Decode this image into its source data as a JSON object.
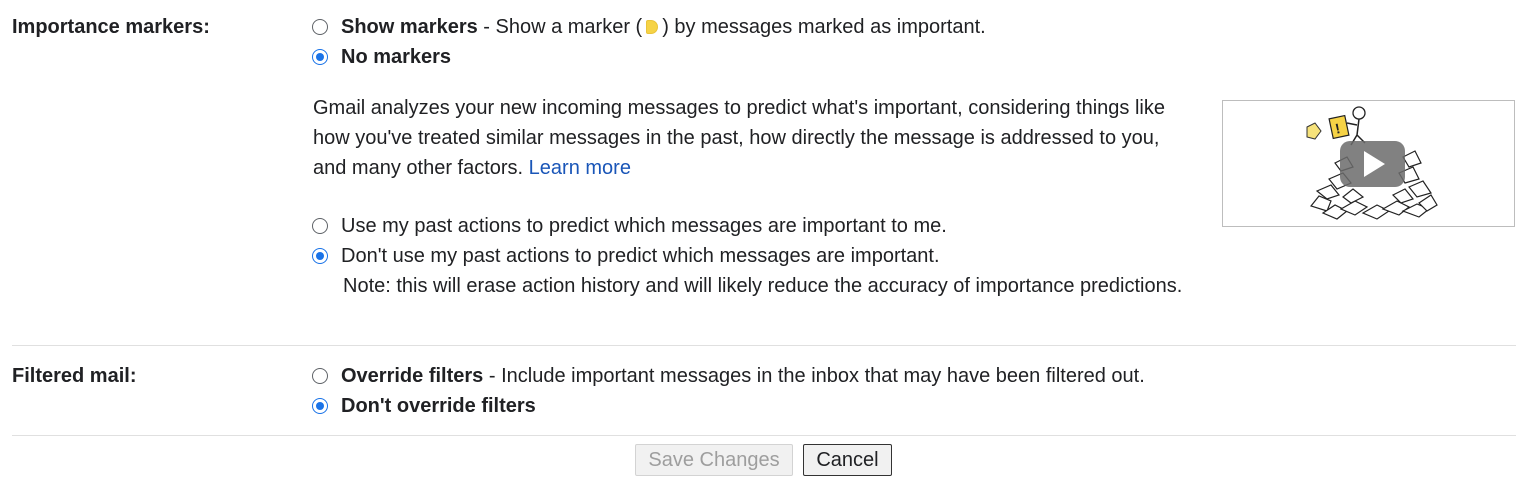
{
  "importance": {
    "label": "Importance markers:",
    "show_markers": {
      "title": "Show markers",
      "desc_before": " - Show a marker (",
      "desc_after": ") by messages marked as important.",
      "checked": false
    },
    "no_markers": {
      "title": "No markers",
      "checked": true
    },
    "explanation": "Gmail analyzes your new incoming messages to predict what's important, considering things like how you've treated similar messages in the past, how directly the message is addressed to you, and many other factors. ",
    "learn_more": "Learn more",
    "use_past_actions": {
      "text": "Use my past actions to predict which messages are important to me.",
      "checked": false
    },
    "dont_use_past_actions": {
      "text": "Don't use my past actions to predict which messages are important.",
      "checked": true
    },
    "note": "Note: this will erase action history and will likely reduce the accuracy of importance predictions."
  },
  "filtered": {
    "label": "Filtered mail:",
    "override": {
      "title": "Override filters",
      "desc": " - Include important messages in the inbox that may have been filtered out.",
      "checked": false
    },
    "dont_override": {
      "title": "Don't override filters",
      "checked": true
    }
  },
  "buttons": {
    "save": "Save Changes",
    "cancel": "Cancel"
  },
  "colors": {
    "accent": "#1a73e8",
    "link": "#1a56b8",
    "marker": "#f6d346"
  },
  "video": {
    "icon": "play-icon"
  }
}
